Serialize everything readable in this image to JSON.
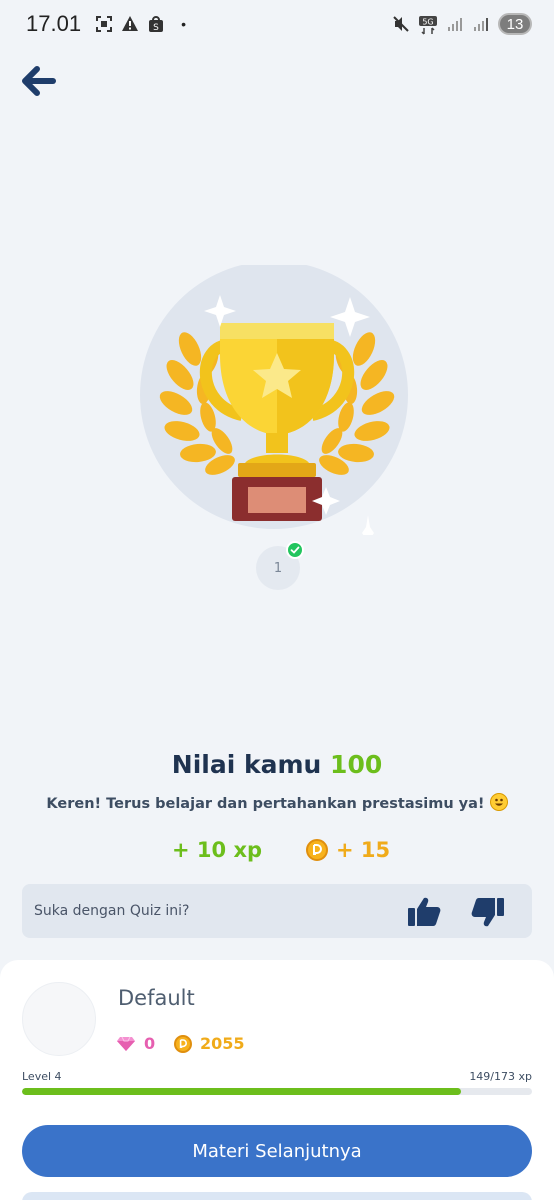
{
  "status_bar": {
    "time": "17.01",
    "network": "5G",
    "battery": "13",
    "icons": [
      "screenshot-icon",
      "warning-icon",
      "shopee-icon",
      "mute-icon",
      "signal-icon",
      "battery-icon"
    ]
  },
  "quiz": {
    "question_number": "1",
    "question_status": "correct"
  },
  "result": {
    "score_prefix": "Nilai kamu",
    "score_value": "100",
    "message": "Keren! Terus belajar dan pertahankan prestasimu ya!",
    "xp_reward": "+ 10 xp",
    "coin_reward": "+ 15"
  },
  "feedback": {
    "label": "Suka dengan Quiz ini?"
  },
  "profile": {
    "name": "Default",
    "gems": "0",
    "coins": "2055",
    "level_label": "Level 4",
    "xp_progress_label": "149/173 xp",
    "xp_current": 149,
    "xp_total": 173
  },
  "actions": {
    "next_label": "Materi Selanjutnya"
  },
  "colors": {
    "background": "#f1f4f8",
    "primary": "#3a73c9",
    "xp_green": "#6cbe1c",
    "coin_orange": "#f0ab1a",
    "gem_pink": "#e65fb0",
    "navy": "#1f3350"
  }
}
